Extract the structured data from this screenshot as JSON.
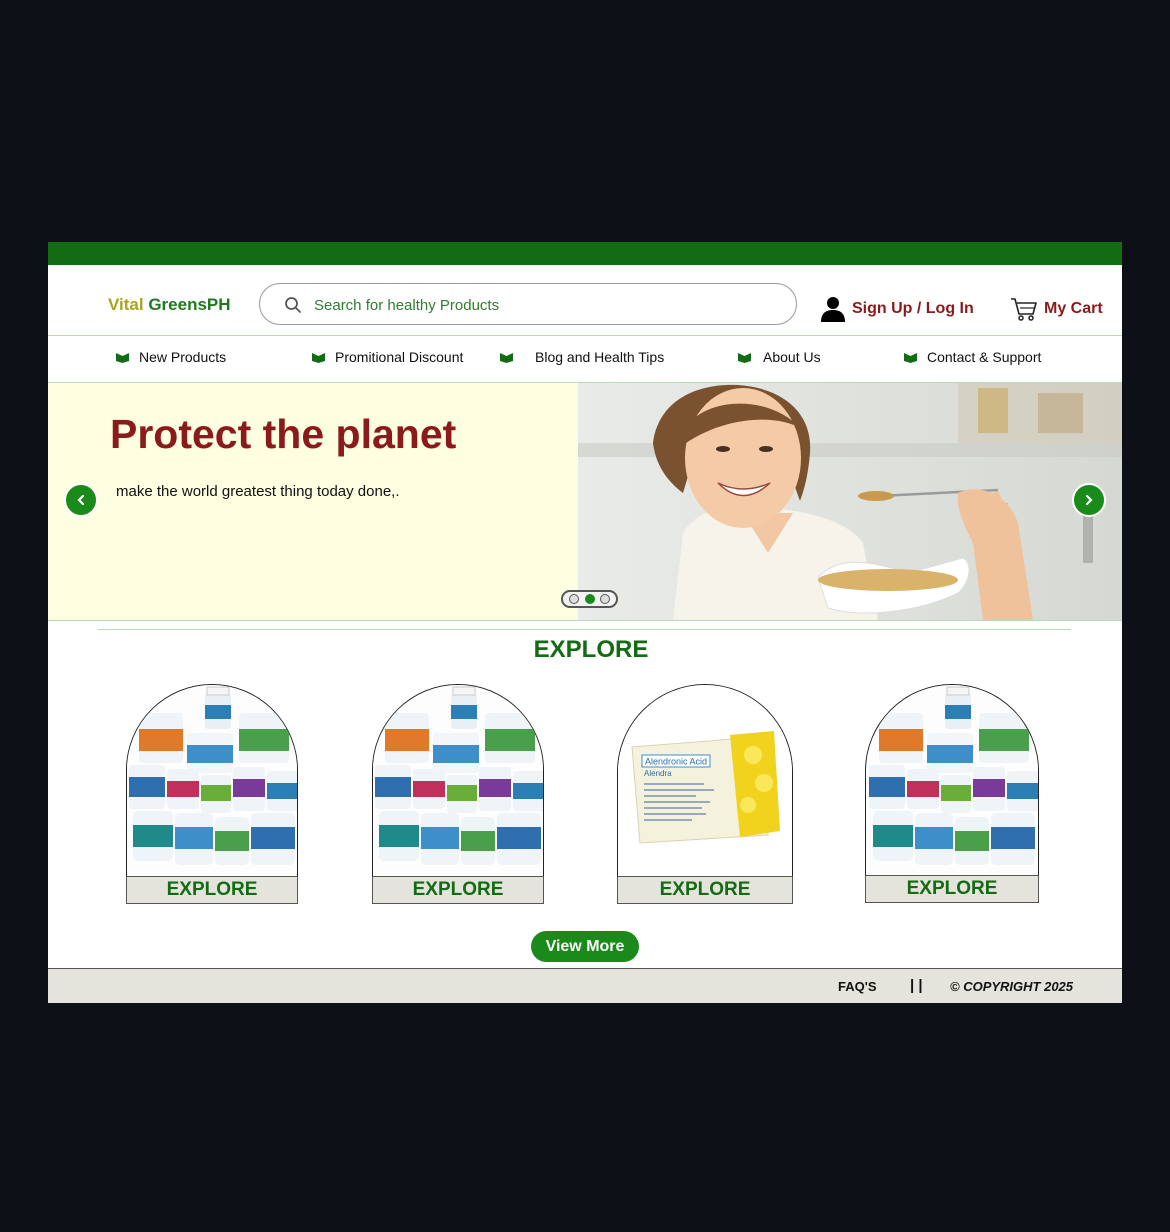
{
  "brand": {
    "part1": "Vital",
    "part2": " GreensPH"
  },
  "search": {
    "placeholder": "Search for healthy Products"
  },
  "header": {
    "signin_label": "Sign Up / Log In",
    "cart_label": "My Cart"
  },
  "nav": {
    "items": [
      {
        "label": "New Products"
      },
      {
        "label": "Promitional Discount"
      },
      {
        "label": "Blog and Health Tips"
      },
      {
        "label": "About Us"
      },
      {
        "label": "Contact & Support"
      }
    ]
  },
  "hero": {
    "title": "Protect the planet",
    "subtitle": "make the world greatest thing today done,.",
    "slide_count": 3,
    "active_slide": 2
  },
  "explore": {
    "title": "EXPLORE",
    "cards": [
      {
        "label": "EXPLORE",
        "image": "supplement-bottles"
      },
      {
        "label": "EXPLORE",
        "image": "supplement-bottles"
      },
      {
        "label": "EXPLORE",
        "image": "medicine-box",
        "box_text": "Alendronic Acid",
        "box_subtext": "Alendra"
      },
      {
        "label": "EXPLORE",
        "image": "supplement-bottles"
      }
    ],
    "view_more_label": "View More"
  },
  "footer": {
    "faq_label": "FAQ'S",
    "separator": "| |",
    "copyright": "© COPYRIGHT 2025"
  },
  "colors": {
    "primary_green": "#136b13",
    "accent_green": "#1a8a1a",
    "brand_red": "#8b1b1b",
    "hero_bg": "#fefee0"
  }
}
